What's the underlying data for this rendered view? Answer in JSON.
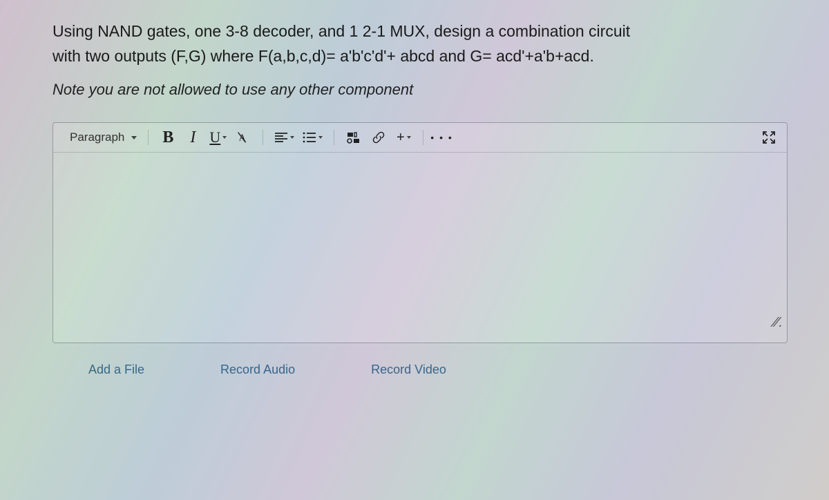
{
  "question": {
    "line1": "Using NAND gates, one 3-8 decoder, and 1 2-1 MUX, design a combination circuit",
    "line2": "with two outputs (F,G) where F(a,b,c,d)= a'b'c'd'+ abcd and G= acd'+a'b+acd."
  },
  "note": "Note you are not allowed to use any other component",
  "toolbar": {
    "style_label": "Paragraph",
    "bold": "B",
    "italic": "I",
    "underline": "U",
    "plus": "+",
    "more": "• • •"
  },
  "attachments": {
    "file": "Add a File",
    "audio": "Record Audio",
    "video": "Record Video"
  }
}
